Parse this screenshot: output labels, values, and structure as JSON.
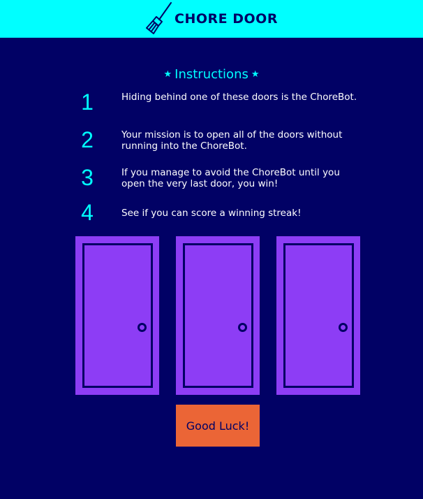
{
  "header": {
    "logo_icon": "broom-icon",
    "title": "CHORE DOOR"
  },
  "instructions": {
    "title": "Instructions",
    "star_icon": "★",
    "steps": [
      {
        "number": "1",
        "text": "Hiding behind one of these doors is the ChoreBot."
      },
      {
        "number": "2",
        "text": "Your mission is to open all of the doors without running into the ChoreBot."
      },
      {
        "number": "3",
        "text": "If you manage to avoid the ChoreBot until you open the very last door, you win!"
      },
      {
        "number": "4",
        "text": "See if you can score a winning streak!"
      }
    ]
  },
  "doors": [
    {
      "state": "closed"
    },
    {
      "state": "closed"
    },
    {
      "state": "closed"
    }
  ],
  "start_button": {
    "label": "Good Luck!"
  },
  "colors": {
    "background": "#010165",
    "header": "#00ffff",
    "accent": "#00ffff",
    "door": "#8d3df5",
    "button": "#eb6536"
  }
}
